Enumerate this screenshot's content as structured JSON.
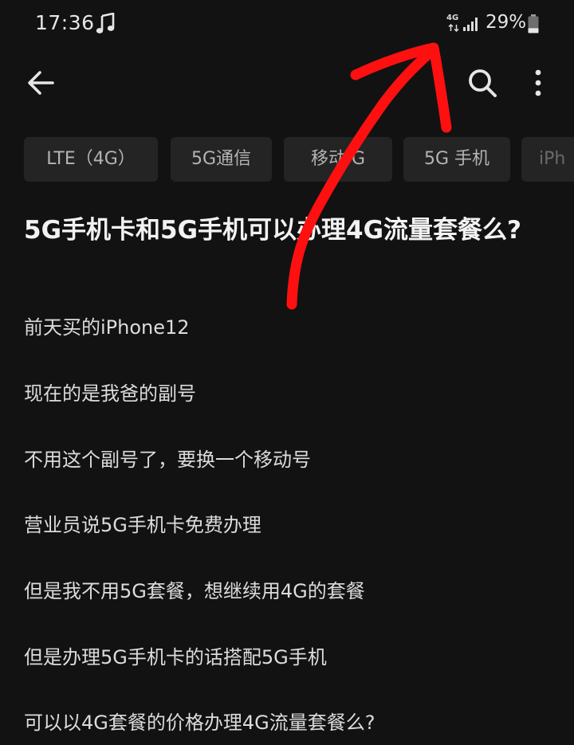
{
  "status_bar": {
    "time": "17:36",
    "network_type": "4G",
    "battery_percent": "29%",
    "battery_level": 0.29,
    "icons": [
      "music-note-icon",
      "network-arrows-icon",
      "signal-icon",
      "battery-icon"
    ]
  },
  "toolbar": {
    "icons": [
      "back-arrow-icon",
      "search-icon",
      "more-vert-icon"
    ]
  },
  "tags": [
    {
      "label": "LTE（4G）"
    },
    {
      "label": "5G通信"
    },
    {
      "label": "移动 G"
    },
    {
      "label": "5G 手机"
    },
    {
      "label": "iPh"
    }
  ],
  "question": {
    "title": "5G手机卡和5G手机可以办理4G流量套餐么?",
    "body": [
      "前天买的iPhone12",
      "现在的是我爸的副号",
      "不用这个副号了，要换一个移动号",
      "营业员说5G手机卡免费办理",
      "但是我不用5G套餐，想继续用4G的套餐",
      "但是办理5G手机卡的话搭配5G手机",
      "可以以4G套餐的价格办理4G流量套餐么?"
    ]
  },
  "colors": {
    "background": "#121212",
    "tag_background": "#242424",
    "tag_text": "#b4b4b4",
    "title_text": "#f2f2f2",
    "body_text": "#dcdcdc",
    "annotation_arrow": "#ff1010"
  }
}
